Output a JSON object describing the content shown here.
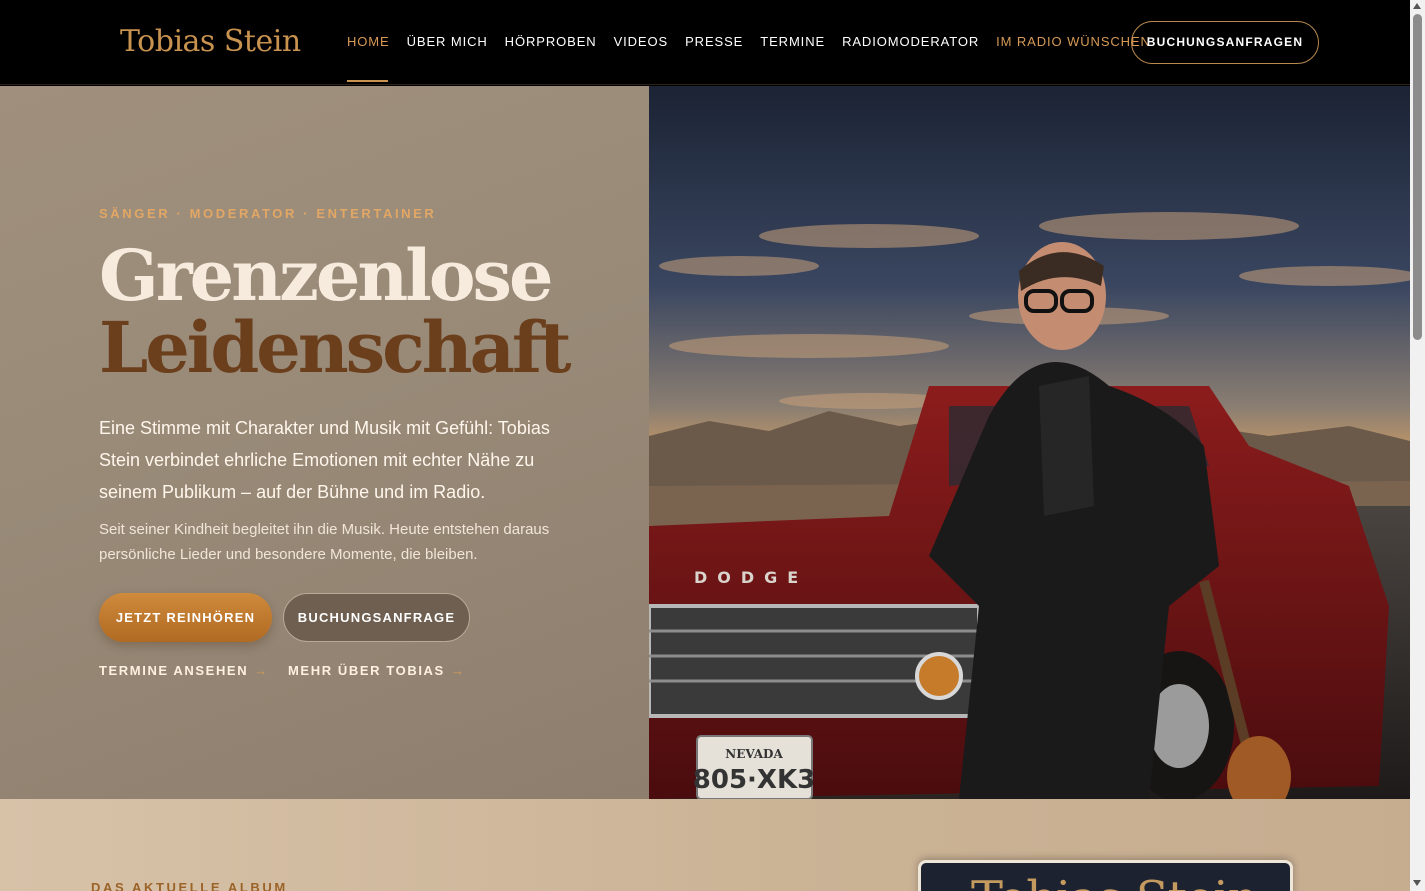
{
  "header": {
    "logo": "Tobias Stein",
    "nav": [
      {
        "label": "HOME"
      },
      {
        "label": "ÜBER MICH"
      },
      {
        "label": "HÖRPROBEN"
      },
      {
        "label": "VIDEOS"
      },
      {
        "label": "PRESSE"
      },
      {
        "label": "TERMINE"
      },
      {
        "label": "RADIOMODERATOR"
      },
      {
        "label": "IM RADIO WÜNSCHEN"
      }
    ],
    "active_item": "HOME",
    "cta": "BUCHUNGSANFRAGEN"
  },
  "hero": {
    "eyebrow": "SÄNGER · MODERATOR · ENTERTAINER",
    "title_line1": "Grenzenlose",
    "title_line2": "Leidenschaft",
    "lead": "Eine Stimme mit Charakter und Musik mit Gefühl: Tobias Stein verbindet ehrliche Emotionen mit echter Nähe zu seinem Publikum – auf der Bühne und im Radio.",
    "sub": "Seit seiner Kindheit begleitet ihn die Musik. Heute entstehen daraus persönliche Lieder und besondere Momente, die bleiben.",
    "primary_button": "JETZT REINHÖREN",
    "secondary_button": "BUCHUNGSANFRAGE",
    "link_dates": "TERMINE ANSEHEN",
    "link_about": "MEHR ÜBER TOBIAS",
    "link_arrow": "→",
    "photo": {
      "truck_brand": "DODGE",
      "plate_state": "NEVADA",
      "plate_number": "805·XK3"
    }
  },
  "album": {
    "eyebrow": "DAS AKTUELLE ALBUM",
    "cover_title": "Tobias Stein"
  },
  "colors": {
    "accent": "#c8924f",
    "header_bg": "#000000",
    "hero_left_bg": "#998a78",
    "title_dark": "#6b3e1c",
    "button_primary": "#c07a30"
  }
}
